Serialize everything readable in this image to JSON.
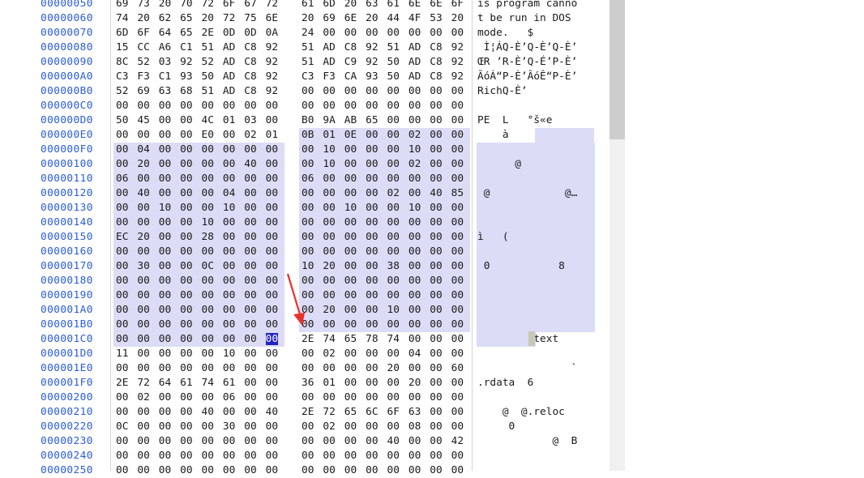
{
  "hex_view": {
    "rows": [
      {
        "offset": "00000050",
        "bytes": [
          "69",
          "73",
          "20",
          "70",
          "72",
          "6F",
          "67",
          "72",
          "61",
          "6D",
          "20",
          "63",
          "61",
          "6E",
          "6E",
          "6F"
        ],
        "ascii": "is program canno"
      },
      {
        "offset": "00000060",
        "bytes": [
          "74",
          "20",
          "62",
          "65",
          "20",
          "72",
          "75",
          "6E",
          "20",
          "69",
          "6E",
          "20",
          "44",
          "4F",
          "53",
          "20"
        ],
        "ascii": "t be run in DOS"
      },
      {
        "offset": "00000070",
        "bytes": [
          "6D",
          "6F",
          "64",
          "65",
          "2E",
          "0D",
          "0D",
          "0A",
          "24",
          "00",
          "00",
          "00",
          "00",
          "00",
          "00",
          "00"
        ],
        "ascii": "mode.   $"
      },
      {
        "offset": "00000080",
        "bytes": [
          "15",
          "CC",
          "A6",
          "C1",
          "51",
          "AD",
          "C8",
          "92",
          "51",
          "AD",
          "C8",
          "92",
          "51",
          "AD",
          "C8",
          "92"
        ],
        "ascii": " Ì¦ÁQ-È’Q-È’Q-È’"
      },
      {
        "offset": "00000090",
        "bytes": [
          "8C",
          "52",
          "03",
          "92",
          "52",
          "AD",
          "C8",
          "92",
          "51",
          "AD",
          "C9",
          "92",
          "50",
          "AD",
          "C8",
          "92"
        ],
        "ascii": "ŒR ’R-È’Q-É’P-È’"
      },
      {
        "offset": "000000A0",
        "bytes": [
          "C3",
          "F3",
          "C1",
          "93",
          "50",
          "AD",
          "C8",
          "92",
          "C3",
          "F3",
          "CA",
          "93",
          "50",
          "AD",
          "C8",
          "92"
        ],
        "ascii": "ÃóÁ“P-È’ÃóÊ“P-È’"
      },
      {
        "offset": "000000B0",
        "bytes": [
          "52",
          "69",
          "63",
          "68",
          "51",
          "AD",
          "C8",
          "92",
          "00",
          "00",
          "00",
          "00",
          "00",
          "00",
          "00",
          "00"
        ],
        "ascii": "RichQ-È’"
      },
      {
        "offset": "000000C0",
        "bytes": [
          "00",
          "00",
          "00",
          "00",
          "00",
          "00",
          "00",
          "00",
          "00",
          "00",
          "00",
          "00",
          "00",
          "00",
          "00",
          "00"
        ],
        "ascii": ""
      },
      {
        "offset": "000000D0",
        "bytes": [
          "50",
          "45",
          "00",
          "00",
          "4C",
          "01",
          "03",
          "00",
          "B0",
          "9A",
          "AB",
          "65",
          "00",
          "00",
          "00",
          "00"
        ],
        "ascii": "PE  L   °š«e"
      },
      {
        "offset": "000000E0",
        "bytes": [
          "00",
          "00",
          "00",
          "00",
          "E0",
          "00",
          "02",
          "01",
          "0B",
          "01",
          "0E",
          "00",
          "00",
          "02",
          "00",
          "00"
        ],
        "ascii": "    à"
      },
      {
        "offset": "000000F0",
        "bytes": [
          "00",
          "04",
          "00",
          "00",
          "00",
          "00",
          "00",
          "00",
          "00",
          "10",
          "00",
          "00",
          "00",
          "10",
          "00",
          "00"
        ],
        "ascii": ""
      },
      {
        "offset": "00000100",
        "bytes": [
          "00",
          "20",
          "00",
          "00",
          "00",
          "00",
          "40",
          "00",
          "00",
          "10",
          "00",
          "00",
          "00",
          "02",
          "00",
          "00"
        ],
        "ascii": "      @"
      },
      {
        "offset": "00000110",
        "bytes": [
          "06",
          "00",
          "00",
          "00",
          "00",
          "00",
          "00",
          "00",
          "06",
          "00",
          "00",
          "00",
          "00",
          "00",
          "00",
          "00"
        ],
        "ascii": ""
      },
      {
        "offset": "00000120",
        "bytes": [
          "00",
          "40",
          "00",
          "00",
          "00",
          "04",
          "00",
          "00",
          "00",
          "00",
          "00",
          "00",
          "02",
          "00",
          "40",
          "85"
        ],
        "ascii": " @            @…"
      },
      {
        "offset": "00000130",
        "bytes": [
          "00",
          "00",
          "10",
          "00",
          "00",
          "10",
          "00",
          "00",
          "00",
          "00",
          "10",
          "00",
          "00",
          "10",
          "00",
          "00"
        ],
        "ascii": ""
      },
      {
        "offset": "00000140",
        "bytes": [
          "00",
          "00",
          "00",
          "00",
          "10",
          "00",
          "00",
          "00",
          "00",
          "00",
          "00",
          "00",
          "00",
          "00",
          "00",
          "00"
        ],
        "ascii": ""
      },
      {
        "offset": "00000150",
        "bytes": [
          "EC",
          "20",
          "00",
          "00",
          "28",
          "00",
          "00",
          "00",
          "00",
          "00",
          "00",
          "00",
          "00",
          "00",
          "00",
          "00"
        ],
        "ascii": "ì   ("
      },
      {
        "offset": "00000160",
        "bytes": [
          "00",
          "00",
          "00",
          "00",
          "00",
          "00",
          "00",
          "00",
          "00",
          "00",
          "00",
          "00",
          "00",
          "00",
          "00",
          "00"
        ],
        "ascii": ""
      },
      {
        "offset": "00000170",
        "bytes": [
          "00",
          "30",
          "00",
          "00",
          "0C",
          "00",
          "00",
          "00",
          "10",
          "20",
          "00",
          "00",
          "38",
          "00",
          "00",
          "00"
        ],
        "ascii": " 0           8"
      },
      {
        "offset": "00000180",
        "bytes": [
          "00",
          "00",
          "00",
          "00",
          "00",
          "00",
          "00",
          "00",
          "00",
          "00",
          "00",
          "00",
          "00",
          "00",
          "00",
          "00"
        ],
        "ascii": ""
      },
      {
        "offset": "00000190",
        "bytes": [
          "00",
          "00",
          "00",
          "00",
          "00",
          "00",
          "00",
          "00",
          "00",
          "00",
          "00",
          "00",
          "00",
          "00",
          "00",
          "00"
        ],
        "ascii": ""
      },
      {
        "offset": "000001A0",
        "bytes": [
          "00",
          "00",
          "00",
          "00",
          "00",
          "00",
          "00",
          "00",
          "00",
          "20",
          "00",
          "00",
          "10",
          "00",
          "00",
          "00"
        ],
        "ascii": ""
      },
      {
        "offset": "000001B0",
        "bytes": [
          "00",
          "00",
          "00",
          "00",
          "00",
          "00",
          "00",
          "00",
          "00",
          "00",
          "00",
          "00",
          "00",
          "00",
          "00",
          "00"
        ],
        "ascii": ""
      },
      {
        "offset": "000001C0",
        "bytes": [
          "00",
          "00",
          "00",
          "00",
          "00",
          "00",
          "00",
          "00",
          "2E",
          "74",
          "65",
          "78",
          "74",
          "00",
          "00",
          "00"
        ],
        "ascii": "        .text"
      },
      {
        "offset": "000001D0",
        "bytes": [
          "11",
          "00",
          "00",
          "00",
          "00",
          "10",
          "00",
          "00",
          "00",
          "02",
          "00",
          "00",
          "00",
          "04",
          "00",
          "00"
        ],
        "ascii": ""
      },
      {
        "offset": "000001E0",
        "bytes": [
          "00",
          "00",
          "00",
          "00",
          "00",
          "00",
          "00",
          "00",
          "00",
          "00",
          "00",
          "00",
          "20",
          "00",
          "00",
          "60"
        ],
        "ascii": "               `"
      },
      {
        "offset": "000001F0",
        "bytes": [
          "2E",
          "72",
          "64",
          "61",
          "74",
          "61",
          "00",
          "00",
          "36",
          "01",
          "00",
          "00",
          "00",
          "20",
          "00",
          "00"
        ],
        "ascii": ".rdata  6"
      },
      {
        "offset": "00000200",
        "bytes": [
          "00",
          "02",
          "00",
          "00",
          "00",
          "06",
          "00",
          "00",
          "00",
          "00",
          "00",
          "00",
          "00",
          "00",
          "00",
          "00"
        ],
        "ascii": ""
      },
      {
        "offset": "00000210",
        "bytes": [
          "00",
          "00",
          "00",
          "00",
          "40",
          "00",
          "00",
          "40",
          "2E",
          "72",
          "65",
          "6C",
          "6F",
          "63",
          "00",
          "00"
        ],
        "ascii": "    @  @.reloc"
      },
      {
        "offset": "00000220",
        "bytes": [
          "0C",
          "00",
          "00",
          "00",
          "00",
          "30",
          "00",
          "00",
          "00",
          "02",
          "00",
          "00",
          "00",
          "08",
          "00",
          "00"
        ],
        "ascii": "     0"
      },
      {
        "offset": "00000230",
        "bytes": [
          "00",
          "00",
          "00",
          "00",
          "00",
          "00",
          "00",
          "00",
          "00",
          "00",
          "00",
          "00",
          "40",
          "00",
          "00",
          "42"
        ],
        "ascii": "            @  B"
      },
      {
        "offset": "00000240",
        "bytes": [
          "00",
          "00",
          "00",
          "00",
          "00",
          "00",
          "00",
          "00",
          "00",
          "00",
          "00",
          "00",
          "00",
          "00",
          "00",
          "00"
        ],
        "ascii": ""
      },
      {
        "offset": "00000250",
        "bytes": [
          "00",
          "00",
          "00",
          "00",
          "00",
          "00",
          "00",
          "00",
          "00",
          "00",
          "00",
          "00",
          "00",
          "00",
          "00",
          "00"
        ],
        "ascii": ""
      }
    ],
    "selection_start_offset": "000000E8",
    "caret_offset": "000001C7",
    "selection_color": "#dcdcf7",
    "caret_color": "#2222c8",
    "offset_color": "#2a5cd8",
    "annotation_color": "#e8322a"
  }
}
